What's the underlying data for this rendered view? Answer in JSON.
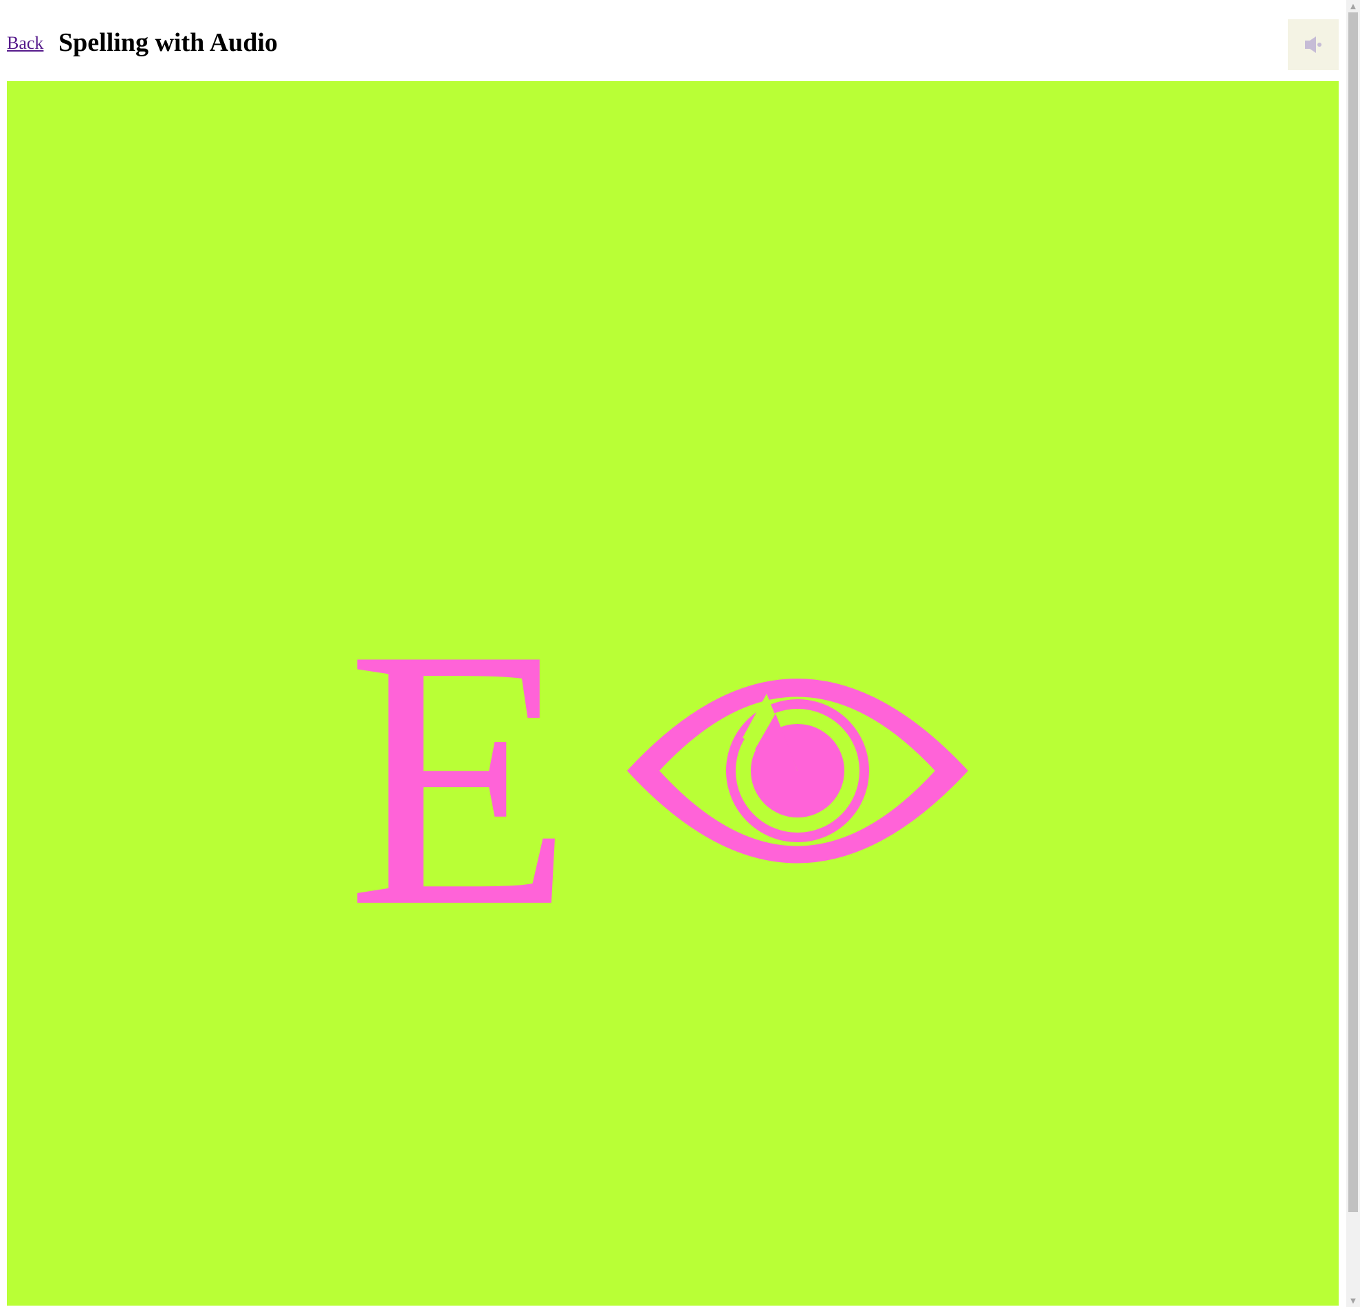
{
  "header": {
    "back_label": "Back",
    "title": "Spelling with Audio"
  },
  "audio_button": {
    "icon": "speaker-icon",
    "icon_color": "#c6bcd6"
  },
  "stage": {
    "background_color": "#b9ff36",
    "glyph_color": "#ff63d8",
    "letter": "E",
    "picture_icon": "eye-icon"
  }
}
